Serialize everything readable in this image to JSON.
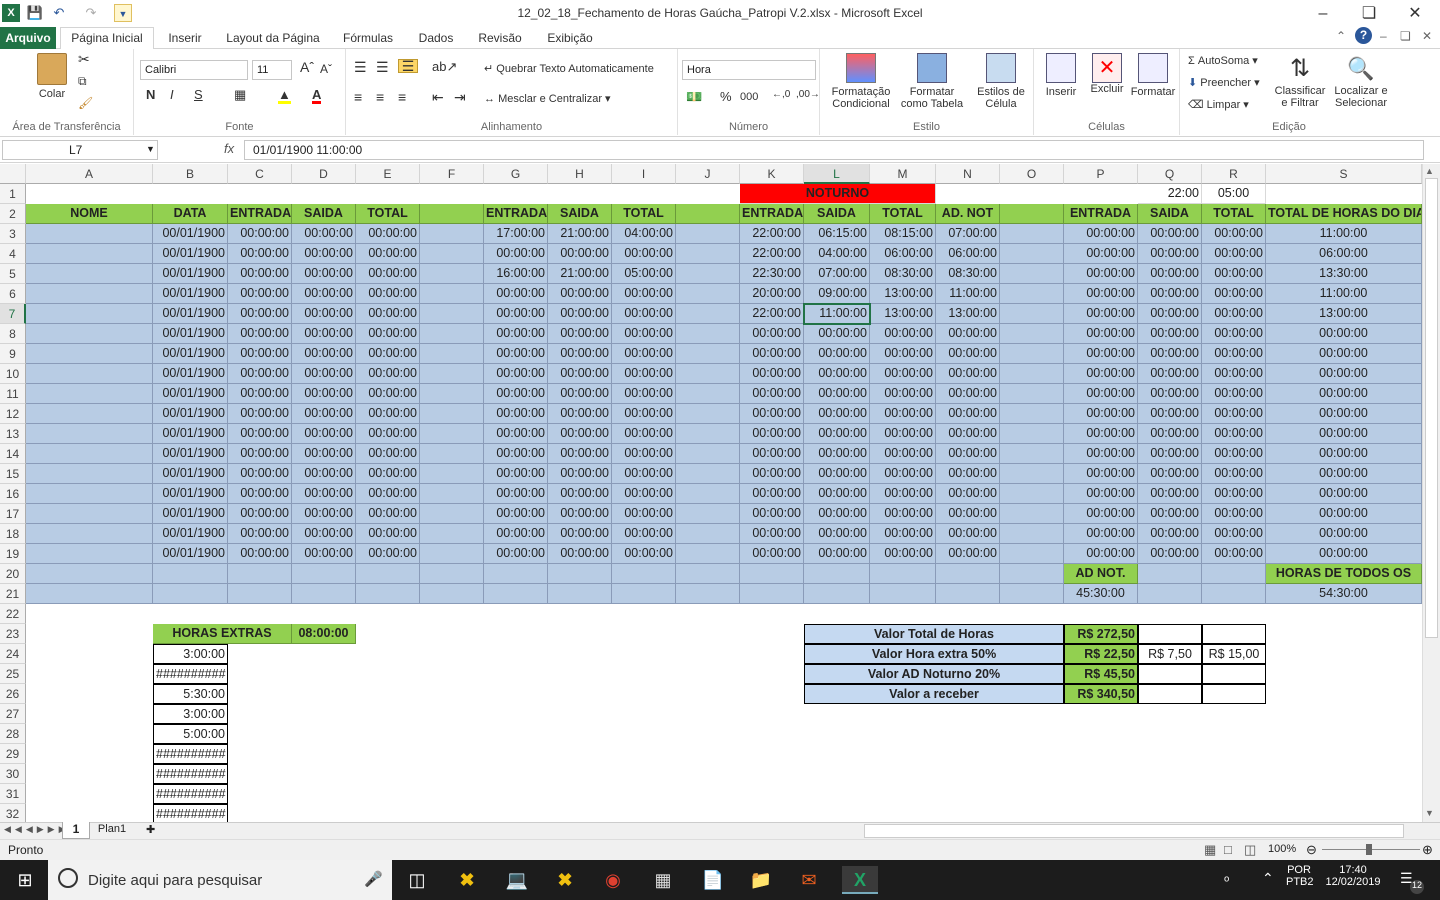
{
  "window": {
    "title": "12_02_18_Fechamento de Horas Gaúcha_Patropi V.2.xlsx  -  Microsoft Excel"
  },
  "tabs": [
    "Arquivo",
    "Página Inicial",
    "Inserir",
    "Layout da Página",
    "Fórmulas",
    "Dados",
    "Revisão",
    "Exibição"
  ],
  "ribbon": {
    "clipboard": {
      "label": "Área de Transferência",
      "paste": "Colar"
    },
    "font": {
      "label": "Fonte",
      "name": "Calibri",
      "size": "11"
    },
    "alignment": {
      "label": "Alinhamento",
      "wrap": "Quebrar Texto Automaticamente",
      "merge": "Mesclar e Centralizar"
    },
    "number": {
      "label": "Número",
      "format": "Hora"
    },
    "styles": {
      "label": "Estilo",
      "cond": "Formatação Condicional",
      "table": "Formatar como Tabela",
      "cell": "Estilos de Célula"
    },
    "cells": {
      "label": "Células",
      "insert": "Inserir",
      "delete": "Excluir",
      "format": "Formatar"
    },
    "editing": {
      "label": "Edição",
      "autosum": "AutoSoma",
      "fill": "Preencher",
      "clear": "Limpar",
      "sort": "Classificar e Filtrar",
      "find": "Localizar e Selecionar"
    }
  },
  "formula": {
    "namebox": "L7",
    "content": "01/01/1900  11:00:00"
  },
  "columns": [
    "A",
    "B",
    "C",
    "D",
    "E",
    "F",
    "G",
    "H",
    "I",
    "J",
    "K",
    "L",
    "M",
    "N",
    "O",
    "P",
    "Q",
    "R",
    "S"
  ],
  "rows": [
    "1",
    "2",
    "3",
    "4",
    "5",
    "6",
    "7",
    "8",
    "9",
    "10",
    "11",
    "12",
    "13",
    "14",
    "15",
    "16",
    "17",
    "18",
    "19",
    "20",
    "21",
    "22",
    "23",
    "24",
    "25",
    "26",
    "27",
    "28",
    "29",
    "30",
    "31",
    "32"
  ],
  "sheet": {
    "row1": {
      "noturno": "NOTURNO",
      "q": "22:00",
      "r": "05:00"
    },
    "headers": [
      "NOME",
      "DATA",
      "ENTRADA",
      "SAIDA",
      "TOTAL",
      "",
      "ENTRADA",
      "SAIDA",
      "TOTAL",
      "",
      "ENTRADA",
      "SAIDA",
      "TOTAL",
      "AD. NOT",
      "",
      "ENTRADA",
      "SAIDA",
      "TOTAL",
      "TOTAL DE HORAS DO DIA"
    ],
    "data": [
      [
        "",
        "00/01/1900",
        "00:00:00",
        "00:00:00",
        "00:00:00",
        "",
        "17:00:00",
        "21:00:00",
        "04:00:00",
        "",
        "22:00:00",
        "06:15:00",
        "08:15:00",
        "07:00:00",
        "",
        "00:00:00",
        "00:00:00",
        "00:00:00",
        "11:00:00"
      ],
      [
        "",
        "00/01/1900",
        "00:00:00",
        "00:00:00",
        "00:00:00",
        "",
        "00:00:00",
        "00:00:00",
        "00:00:00",
        "",
        "22:00:00",
        "04:00:00",
        "06:00:00",
        "06:00:00",
        "",
        "00:00:00",
        "00:00:00",
        "00:00:00",
        "06:00:00"
      ],
      [
        "",
        "00/01/1900",
        "00:00:00",
        "00:00:00",
        "00:00:00",
        "",
        "16:00:00",
        "21:00:00",
        "05:00:00",
        "",
        "22:30:00",
        "07:00:00",
        "08:30:00",
        "08:30:00",
        "",
        "00:00:00",
        "00:00:00",
        "00:00:00",
        "13:30:00"
      ],
      [
        "",
        "00/01/1900",
        "00:00:00",
        "00:00:00",
        "00:00:00",
        "",
        "00:00:00",
        "00:00:00",
        "00:00:00",
        "",
        "20:00:00",
        "09:00:00",
        "13:00:00",
        "11:00:00",
        "",
        "00:00:00",
        "00:00:00",
        "00:00:00",
        "11:00:00"
      ],
      [
        "",
        "00/01/1900",
        "00:00:00",
        "00:00:00",
        "00:00:00",
        "",
        "00:00:00",
        "00:00:00",
        "00:00:00",
        "",
        "22:00:00",
        "11:00:00",
        "13:00:00",
        "13:00:00",
        "",
        "00:00:00",
        "00:00:00",
        "00:00:00",
        "13:00:00"
      ],
      [
        "",
        "00/01/1900",
        "00:00:00",
        "00:00:00",
        "00:00:00",
        "",
        "00:00:00",
        "00:00:00",
        "00:00:00",
        "",
        "00:00:00",
        "00:00:00",
        "00:00:00",
        "00:00:00",
        "",
        "00:00:00",
        "00:00:00",
        "00:00:00",
        "00:00:00"
      ],
      [
        "",
        "00/01/1900",
        "00:00:00",
        "00:00:00",
        "00:00:00",
        "",
        "00:00:00",
        "00:00:00",
        "00:00:00",
        "",
        "00:00:00",
        "00:00:00",
        "00:00:00",
        "00:00:00",
        "",
        "00:00:00",
        "00:00:00",
        "00:00:00",
        "00:00:00"
      ],
      [
        "",
        "00/01/1900",
        "00:00:00",
        "00:00:00",
        "00:00:00",
        "",
        "00:00:00",
        "00:00:00",
        "00:00:00",
        "",
        "00:00:00",
        "00:00:00",
        "00:00:00",
        "00:00:00",
        "",
        "00:00:00",
        "00:00:00",
        "00:00:00",
        "00:00:00"
      ],
      [
        "",
        "00/01/1900",
        "00:00:00",
        "00:00:00",
        "00:00:00",
        "",
        "00:00:00",
        "00:00:00",
        "00:00:00",
        "",
        "00:00:00",
        "00:00:00",
        "00:00:00",
        "00:00:00",
        "",
        "00:00:00",
        "00:00:00",
        "00:00:00",
        "00:00:00"
      ],
      [
        "",
        "00/01/1900",
        "00:00:00",
        "00:00:00",
        "00:00:00",
        "",
        "00:00:00",
        "00:00:00",
        "00:00:00",
        "",
        "00:00:00",
        "00:00:00",
        "00:00:00",
        "00:00:00",
        "",
        "00:00:00",
        "00:00:00",
        "00:00:00",
        "00:00:00"
      ],
      [
        "",
        "00/01/1900",
        "00:00:00",
        "00:00:00",
        "00:00:00",
        "",
        "00:00:00",
        "00:00:00",
        "00:00:00",
        "",
        "00:00:00",
        "00:00:00",
        "00:00:00",
        "00:00:00",
        "",
        "00:00:00",
        "00:00:00",
        "00:00:00",
        "00:00:00"
      ],
      [
        "",
        "00/01/1900",
        "00:00:00",
        "00:00:00",
        "00:00:00",
        "",
        "00:00:00",
        "00:00:00",
        "00:00:00",
        "",
        "00:00:00",
        "00:00:00",
        "00:00:00",
        "00:00:00",
        "",
        "00:00:00",
        "00:00:00",
        "00:00:00",
        "00:00:00"
      ],
      [
        "",
        "00/01/1900",
        "00:00:00",
        "00:00:00",
        "00:00:00",
        "",
        "00:00:00",
        "00:00:00",
        "00:00:00",
        "",
        "00:00:00",
        "00:00:00",
        "00:00:00",
        "00:00:00",
        "",
        "00:00:00",
        "00:00:00",
        "00:00:00",
        "00:00:00"
      ],
      [
        "",
        "00/01/1900",
        "00:00:00",
        "00:00:00",
        "00:00:00",
        "",
        "00:00:00",
        "00:00:00",
        "00:00:00",
        "",
        "00:00:00",
        "00:00:00",
        "00:00:00",
        "00:00:00",
        "",
        "00:00:00",
        "00:00:00",
        "00:00:00",
        "00:00:00"
      ],
      [
        "",
        "00/01/1900",
        "00:00:00",
        "00:00:00",
        "00:00:00",
        "",
        "00:00:00",
        "00:00:00",
        "00:00:00",
        "",
        "00:00:00",
        "00:00:00",
        "00:00:00",
        "00:00:00",
        "",
        "00:00:00",
        "00:00:00",
        "00:00:00",
        "00:00:00"
      ],
      [
        "",
        "00/01/1900",
        "00:00:00",
        "00:00:00",
        "00:00:00",
        "",
        "00:00:00",
        "00:00:00",
        "00:00:00",
        "",
        "00:00:00",
        "00:00:00",
        "00:00:00",
        "00:00:00",
        "",
        "00:00:00",
        "00:00:00",
        "00:00:00",
        "00:00:00"
      ],
      [
        "",
        "00/01/1900",
        "00:00:00",
        "00:00:00",
        "00:00:00",
        "",
        "00:00:00",
        "00:00:00",
        "00:00:00",
        "",
        "00:00:00",
        "00:00:00",
        "00:00:00",
        "00:00:00",
        "",
        "00:00:00",
        "00:00:00",
        "00:00:00",
        "00:00:00"
      ]
    ],
    "row20": {
      "adnot": "AD NOT.",
      "todos": "HORAS DE TODOS OS"
    },
    "row21": {
      "adnot": "45:30:00",
      "todos": "54:30:00"
    },
    "horas_extras": {
      "label": "HORAS EXTRAS",
      "value": "08:00:00",
      "list": [
        "3:00:00",
        "##########",
        "5:30:00",
        "3:00:00",
        "5:00:00",
        "##########",
        "##########",
        "##########",
        "##########"
      ]
    },
    "summary": [
      {
        "label": "Valor Total de Horas",
        "value": "R$ 272,50",
        "q": "",
        "r": ""
      },
      {
        "label": "Valor Hora extra 50%",
        "value": "R$ 22,50",
        "q": "R$ 7,50",
        "r": "R$ 15,00"
      },
      {
        "label": "Valor AD Noturno 20%",
        "value": "R$ 45,50",
        "q": "",
        "r": ""
      },
      {
        "label": "Valor a receber",
        "value": "R$  340,50",
        "q": "",
        "r": ""
      }
    ]
  },
  "sheettabs": [
    "1",
    "Plan1"
  ],
  "status": {
    "ready": "Pronto",
    "zoom": "100%"
  },
  "taskbar": {
    "search": "Digite aqui para pesquisar",
    "lang1": "POR",
    "lang2": "PTB2",
    "time": "17:40",
    "date": "12/02/2019",
    "notif": "12"
  }
}
